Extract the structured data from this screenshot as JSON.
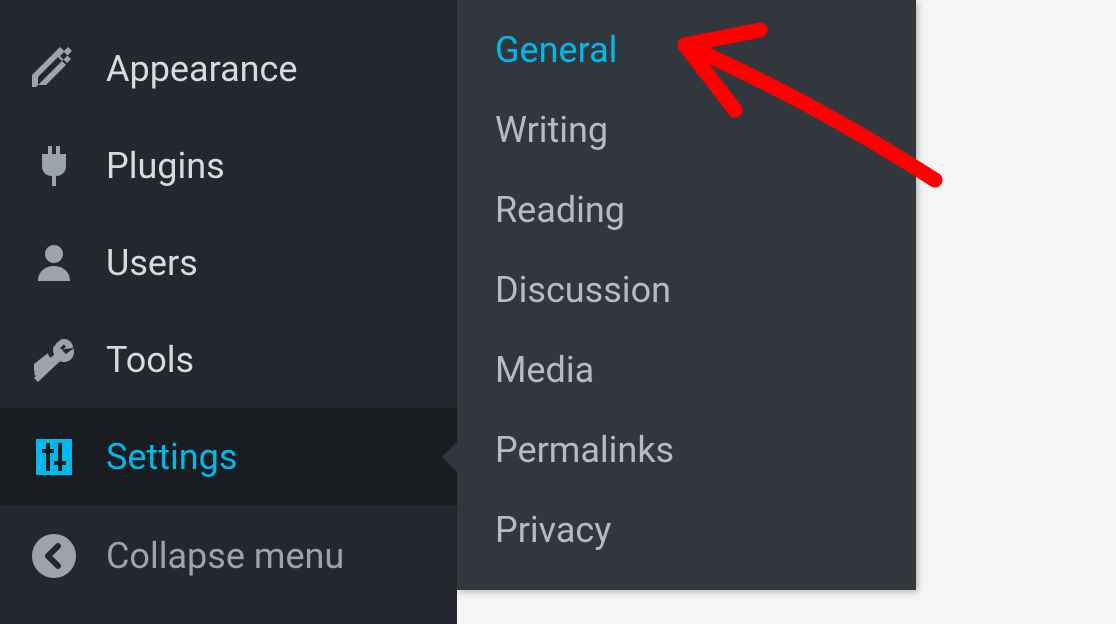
{
  "sidebar": {
    "items": [
      {
        "label": "Appearance",
        "icon": "appearance"
      },
      {
        "label": "Plugins",
        "icon": "plugins"
      },
      {
        "label": "Users",
        "icon": "users"
      },
      {
        "label": "Tools",
        "icon": "tools"
      },
      {
        "label": "Settings",
        "icon": "settings"
      },
      {
        "label": "Collapse menu",
        "icon": "collapse"
      }
    ]
  },
  "submenu": {
    "items": [
      "General",
      "Writing",
      "Reading",
      "Discussion",
      "Media",
      "Permalinks",
      "Privacy"
    ]
  }
}
